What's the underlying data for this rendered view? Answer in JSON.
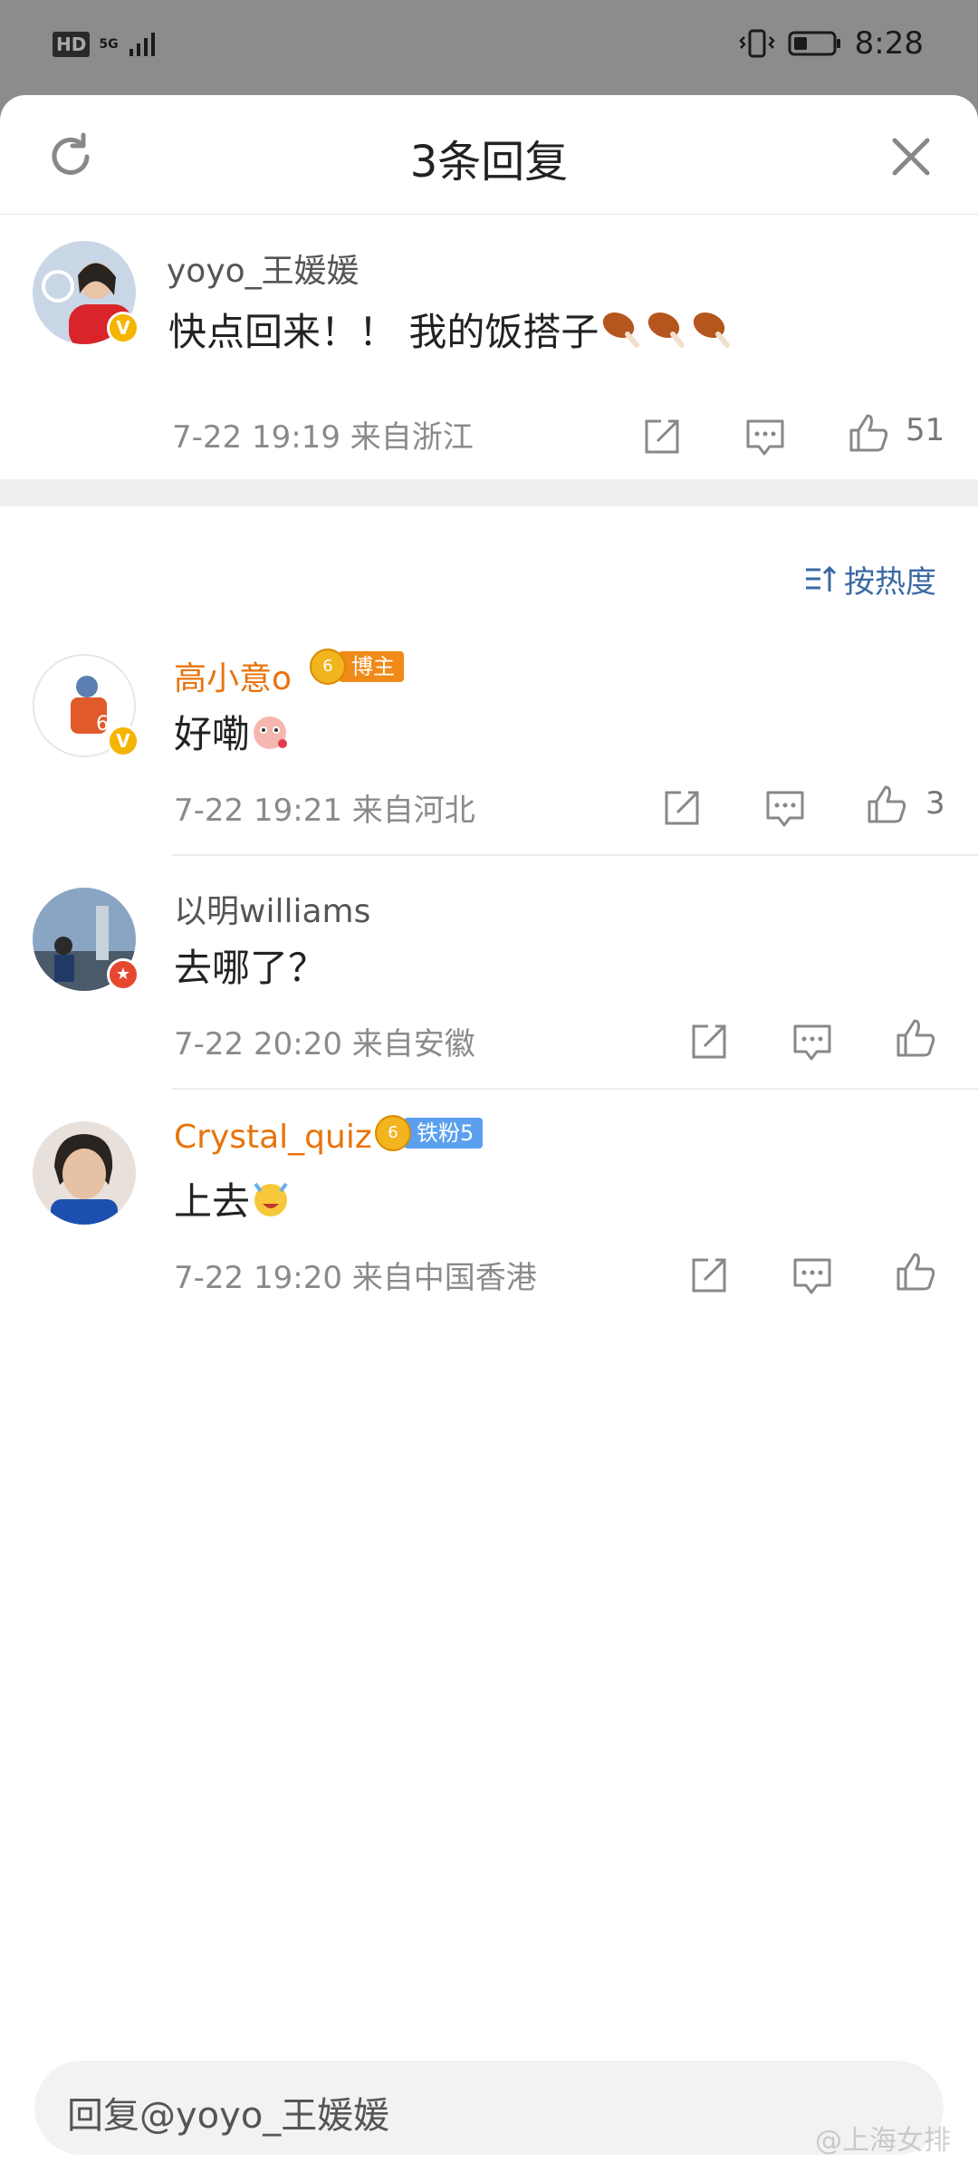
{
  "status_bar": {
    "network": "HD",
    "signal_label": "5G",
    "time": "8:28"
  },
  "sheet": {
    "title": "3条回复"
  },
  "root_comment": {
    "username": "yoyo_王媛媛",
    "text": "快点回来！！ 我的饭搭子",
    "time": "7-22 19:19",
    "location": "来自浙江",
    "likes": "51",
    "verified": "V"
  },
  "sort": {
    "label": "按热度"
  },
  "replies": [
    {
      "username": "高小意o",
      "badge_level": "6",
      "badge_label": "博主",
      "text": "好嘞",
      "time": "7-22 19:21",
      "location": "来自河北",
      "likes": "3",
      "verified": "V"
    },
    {
      "username": "以明williams",
      "text": "去哪了？",
      "time": "7-22 20:20",
      "location": "来自安徽",
      "likes": ""
    },
    {
      "username": "Crystal_quiz",
      "badge_level": "6",
      "badge_label": "铁粉5",
      "text": "上去",
      "time": "7-22 19:20",
      "location": "来自中国香港",
      "likes": ""
    }
  ],
  "reply_bar": {
    "placeholder": "回复@yoyo_王媛媛"
  },
  "watermark": "@上海女排",
  "colors": {
    "accent_orange": "#e8730c",
    "sort_blue": "#3a6aa3",
    "verified_gold": "#f5b400"
  }
}
